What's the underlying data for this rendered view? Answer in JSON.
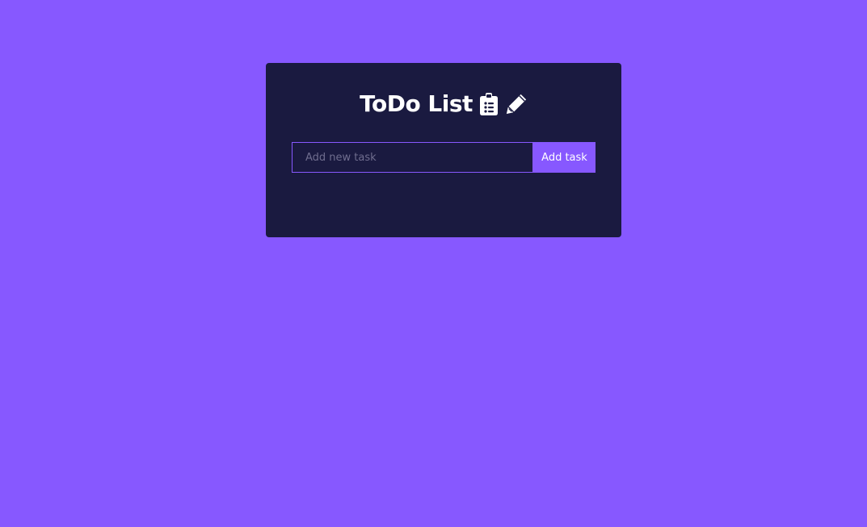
{
  "app": {
    "title": "ToDo List"
  },
  "header": {
    "icons": [
      "clipboard-list-icon",
      "pencil-icon"
    ]
  },
  "form": {
    "input_value": "",
    "input_placeholder": "Add new task",
    "add_button_label": "Add task"
  },
  "colors": {
    "background": "#8758ff",
    "card": "#1a1a40",
    "accent": "#8758ff",
    "text": "#ffffff"
  }
}
